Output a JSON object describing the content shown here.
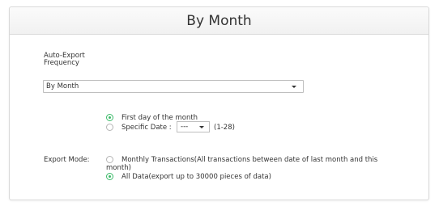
{
  "dialog": {
    "title": "By Month"
  },
  "frequency": {
    "label_line1": "Auto-Export",
    "label_line2": "Frequency",
    "selected": "By Month"
  },
  "day_options": {
    "first_day": "First day of the month",
    "specific_date_label": "Specific Date :",
    "specific_date_value": "---",
    "specific_date_range": "(1-28)"
  },
  "export_mode": {
    "label": "Export Mode:",
    "monthly_line1": "Monthly Transactions(All transactions between date of last month and this",
    "monthly_line2": "month)",
    "all_data": "All Data(export up to 30000 pieces of data)"
  },
  "colors": {
    "accent": "#3dbb6a"
  }
}
